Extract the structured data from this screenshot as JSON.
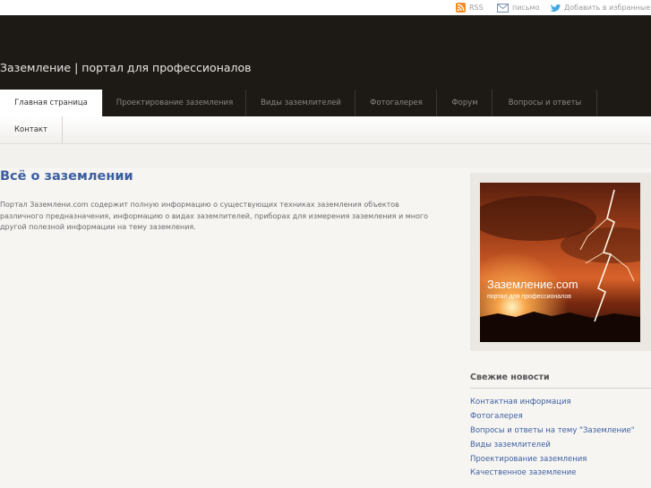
{
  "topbar": {
    "rss_label": "RSS",
    "mail_label": "письмо",
    "favorites_label": "Добавить в избранные"
  },
  "header": {
    "site_title": "Заземление | портал для профессионалов"
  },
  "nav": {
    "items": [
      {
        "label": "Главная страница",
        "active": true
      },
      {
        "label": "Проектирование заземления"
      },
      {
        "label": "Виды заземлителей"
      },
      {
        "label": "Фотогалерея"
      },
      {
        "label": "Форум"
      },
      {
        "label": "Вопросы и ответы"
      },
      {
        "label": "Контакт"
      }
    ]
  },
  "main": {
    "heading": "Всё о заземлении",
    "text": "Портал Заземлени.com содержит полную информацию о существующих техниках заземления объектов различного предназначения, информацию о видах заземлителей, приборах для измерения заземления и много другой полезной информации на тему заземления."
  },
  "sidebar": {
    "banner": {
      "title": "Заземление.com",
      "subtitle": "портал для профессионалов"
    },
    "news_title": "Свежие новости",
    "news_items": [
      "Контактная информация",
      "Фотогалерея",
      "Вопросы и ответы на тему \"Заземление\"",
      "Виды заземлителей",
      "Проектирование заземления",
      "Качественное заземление"
    ]
  },
  "colors": {
    "header_bg": "#1d1a16",
    "link": "#3b5fa0",
    "page_bg": "#f7f5f2"
  },
  "icons": {
    "rss": "rss-icon",
    "mail": "mail-icon",
    "favorites": "twitter-bird-icon"
  }
}
